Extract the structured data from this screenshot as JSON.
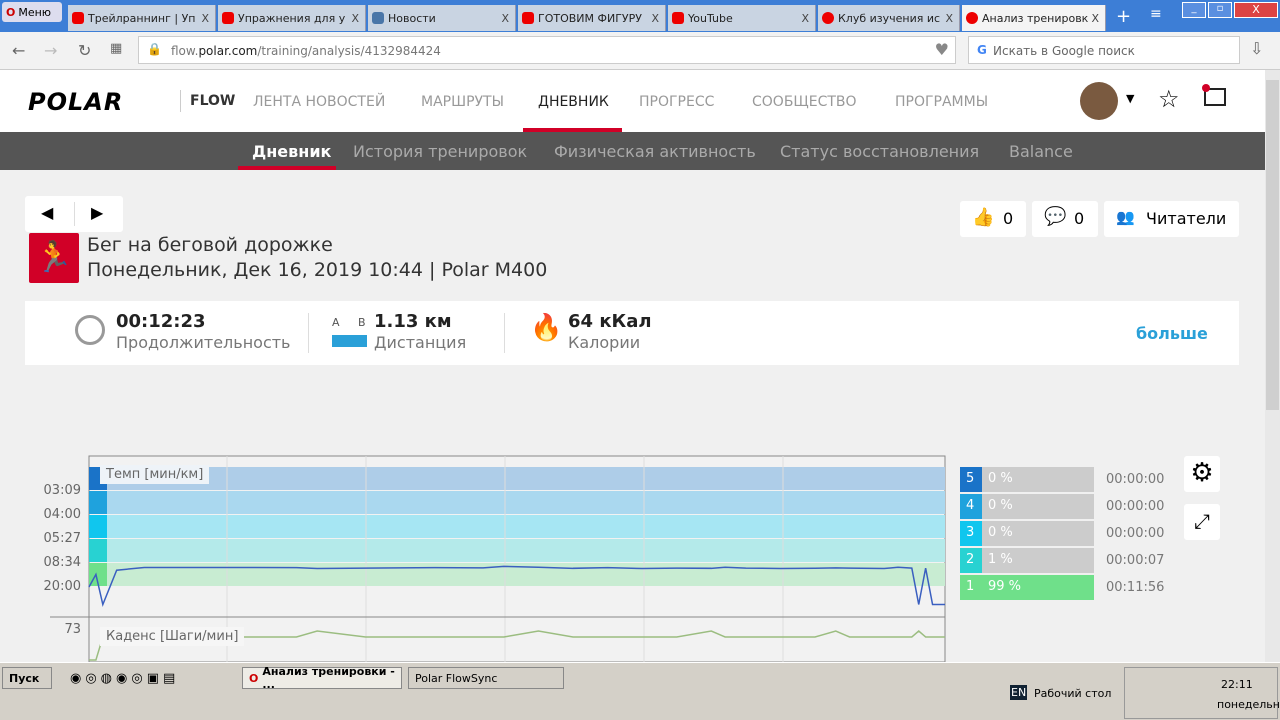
{
  "browser": {
    "menu": "Меню",
    "tabs": [
      {
        "title": "Трейлраннинг | Уп"
      },
      {
        "title": "Упражнения для у"
      },
      {
        "title": "Новости"
      },
      {
        "title": "ГОТОВИМ ФИГУРУ"
      },
      {
        "title": "YouTube"
      },
      {
        "title": "Клуб изучения ис"
      },
      {
        "title": "Анализ тренировк"
      }
    ],
    "url_prefix": "flow.",
    "url_domain": "polar.com",
    "url_path": "/training/analysis/4132984424",
    "search_placeholder": "Искать в Google поиск"
  },
  "header": {
    "logo": "POLAR",
    "flow": "FLOW",
    "nav": [
      "ЛЕНТА НОВОСТЕЙ",
      "МАРШРУТЫ",
      "ДНЕВНИК",
      "ПРОГРЕСС",
      "СООБЩЕСТВО",
      "ПРОГРАММЫ"
    ]
  },
  "subnav": [
    "Дневник",
    "История тренировок",
    "Физическая активность",
    "Статус восстановления",
    "Balance"
  ],
  "training": {
    "title": "Бег на беговой дорожке",
    "subtitle": "Понедельник, Дек 16, 2019 10:44 | Polar M400",
    "likes": "0",
    "comments": "0",
    "readers": "Читатели"
  },
  "stats": {
    "duration": "00:12:23",
    "duration_label": "Продолжительность",
    "dist_a": "A",
    "dist_b": "B",
    "distance": "1.13 км",
    "distance_label": "Дистанция",
    "calories": "64 кКал",
    "calories_label": "Калории",
    "more": "больше"
  },
  "chart_data": {
    "type": "line",
    "title": "Темп [мин/км]",
    "yticks": [
      "03:09",
      "04:00",
      "05:27",
      "08:34",
      "20:00"
    ],
    "ytick_minutes": [
      3.15,
      4.0,
      5.45,
      8.57,
      20.0
    ],
    "x_minutes": [
      0,
      0.1,
      0.2,
      0.4,
      0.8,
      1.5,
      2,
      3,
      3.3,
      4,
      5,
      5.7,
      6,
      6.5,
      7,
      7.5,
      8,
      8.5,
      9,
      9.2,
      9.5,
      10,
      10.5,
      10.8,
      11,
      11.5,
      11.7,
      11.9,
      12,
      12.1,
      12.2,
      12.38
    ],
    "pace_minutes": [
      20,
      14,
      25,
      12,
      10.7,
      10.7,
      10.7,
      10.8,
      11.2,
      11,
      10.8,
      10.9,
      10.2,
      10.6,
      11.1,
      10.8,
      11.2,
      11,
      11.1,
      10.6,
      11,
      11.2,
      11.1,
      10.9,
      11,
      11.2,
      10.6,
      11,
      25,
      11,
      25,
      25
    ],
    "cadence_label": "Каденс [Шаги/мин]",
    "cadence_tick": "73",
    "zones": [
      {
        "n": "5",
        "pct": "0 %",
        "time": "00:00:00",
        "color": "#1a73c8",
        "band": "#aecde8"
      },
      {
        "n": "4",
        "pct": "0 %",
        "time": "00:00:00",
        "color": "#1fa2dd",
        "band": "#aad8ef"
      },
      {
        "n": "3",
        "pct": "0 %",
        "time": "00:00:00",
        "color": "#10c6ee",
        "band": "#a6e6f3"
      },
      {
        "n": "2",
        "pct": "1 %",
        "time": "00:00:07",
        "color": "#28d2d2",
        "band": "#b4eaea"
      },
      {
        "n": "1",
        "pct": "99 %",
        "time": "00:11:56",
        "color": "#6fe08a",
        "band": "#c8ecd2"
      }
    ],
    "zone_fill": {
      "1": 0.99
    }
  },
  "taskbar": {
    "start": "Пуск",
    "windows": [
      "Анализ тренировки - ...",
      "Polar FlowSync"
    ],
    "lang": "EN",
    "desktop": "Рабочий стол",
    "time": "22:11",
    "day": "понедельник"
  }
}
